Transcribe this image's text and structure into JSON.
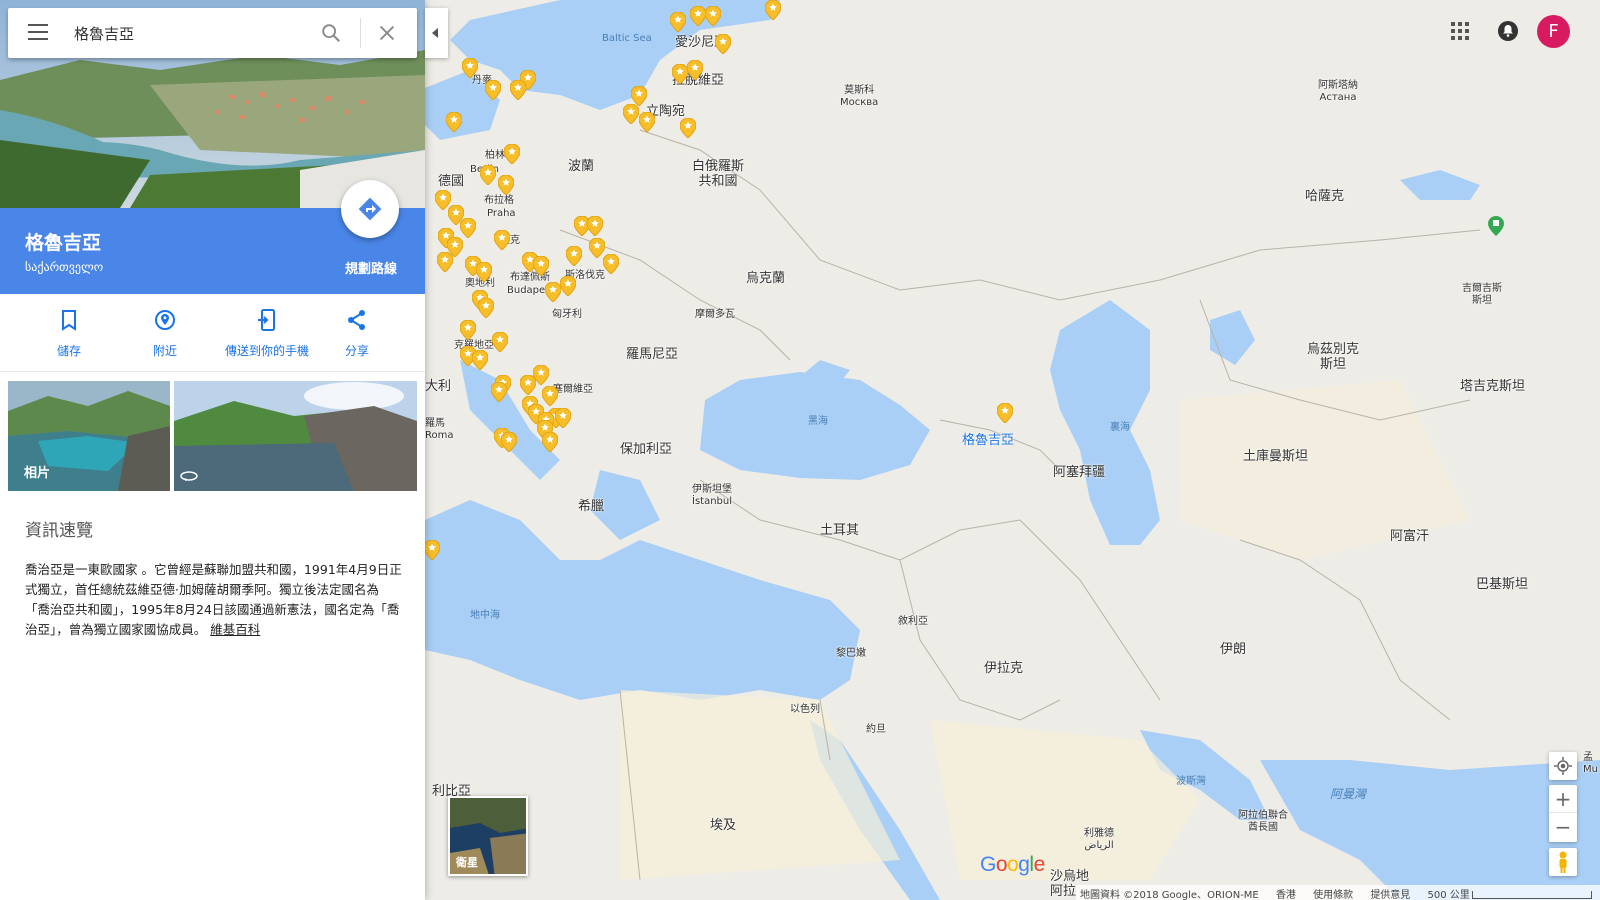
{
  "search": {
    "query": "格魯吉亞"
  },
  "place": {
    "name": "格魯吉亞",
    "native_name": "საქართველო",
    "route_label": "規劃路線"
  },
  "actions": [
    {
      "label": "儲存",
      "icon": "bookmark-icon"
    },
    {
      "label": "附近",
      "icon": "nearby-icon"
    },
    {
      "label": "傳送到你的手機",
      "icon": "send-to-phone-icon"
    },
    {
      "label": "分享",
      "icon": "share-icon"
    }
  ],
  "photos": {
    "photos_label": "相片"
  },
  "overview": {
    "heading": "資訊速覽",
    "text": "喬治亞是一東歐國家 。它曾經是蘇聯加盟共和國，1991年4月9日正式獨立，首任總統茲維亞德·加姆薩胡爾季阿。獨立後法定國名為「喬治亞共和國」，1995年8月24日該國通過新憲法，國名定為「喬治亞」，曾為獨立國家國協成員。",
    "link": "維基百科"
  },
  "account": {
    "avatar_letter": "F"
  },
  "satellite": {
    "label": "衛星"
  },
  "zoom": {
    "in": "+",
    "out": "−"
  },
  "logo": "Google",
  "footer": {
    "attribution": "地圖資料 ©2018 Google、ORION-ME",
    "region": "香港",
    "terms": "使用條款",
    "feedback": "提供意見",
    "scale": "500 公里"
  },
  "colors": {
    "water": "#a9cff6",
    "land": "#eeece6",
    "accent_blue": "#4a86e8",
    "pin_yellow": "#f7be2a",
    "avatar": "#d81b60"
  },
  "map_labels": {
    "baltic": "Baltic Sea",
    "estonia": "愛沙尼亞",
    "latvia": "拉脫維亞",
    "lithuania": "立陶宛",
    "denmark": "丹麥",
    "berlin": "柏林",
    "berlin_latin": "Berlin",
    "germany": "德國",
    "poland": "波蘭",
    "prague": "布拉格",
    "prague_latin": "Praha",
    "czech": "捷克",
    "belarus": "白俄羅斯\n共和國",
    "moscow": "莫斯科\nМосква",
    "astana": "阿斯塔納\nАстана",
    "kazakhstan": "哈薩克",
    "ukraine": "烏克蘭",
    "austria": "奧地利",
    "budapest": "布達佩斯",
    "budapest_latin": "Budapest",
    "slovakia": "斯洛伐克",
    "hungary": "匈牙利",
    "moldova": "摩爾多瓦",
    "romania": "羅馬尼亞",
    "croatia": "克羅地亞",
    "italy_partial": "大利",
    "rome": "羅馬\nRoma",
    "serbia": "塞爾維亞",
    "bulgaria": "保加利亞",
    "black_sea": "黑海",
    "georgia": "格魯吉亞",
    "caspian": "裏海",
    "azerbaijan": "阿塞拜疆",
    "uzbekistan": "烏茲別克\n斯坦",
    "kyrgyzstan": "吉爾吉斯\n斯坦",
    "tajikistan": "塔吉克斯坦",
    "turkmenistan": "土庫曼斯坦",
    "istanbul": "伊斯坦堡\nİstanbul",
    "greece": "希臘",
    "turkey": "土耳其",
    "afghanistan": "阿富汗",
    "pakistan": "巴基斯坦",
    "mediterranean": "地中海",
    "syria": "敘利亞",
    "lebanon": "黎巴嫩",
    "iraq": "伊拉克",
    "iran": "伊朗",
    "israel": "以色列",
    "jordan": "約旦",
    "libya_partial": "利比亞",
    "egypt": "埃及",
    "persian_gulf": "波斯灣",
    "uae": "阿拉伯聯合\n酋長國",
    "arabian_sea": "阿曼灣",
    "riyadh": "利雅德\nالرياض",
    "saudi": "沙烏地\n阿拉",
    "mu_partial": "孟\nMu"
  }
}
